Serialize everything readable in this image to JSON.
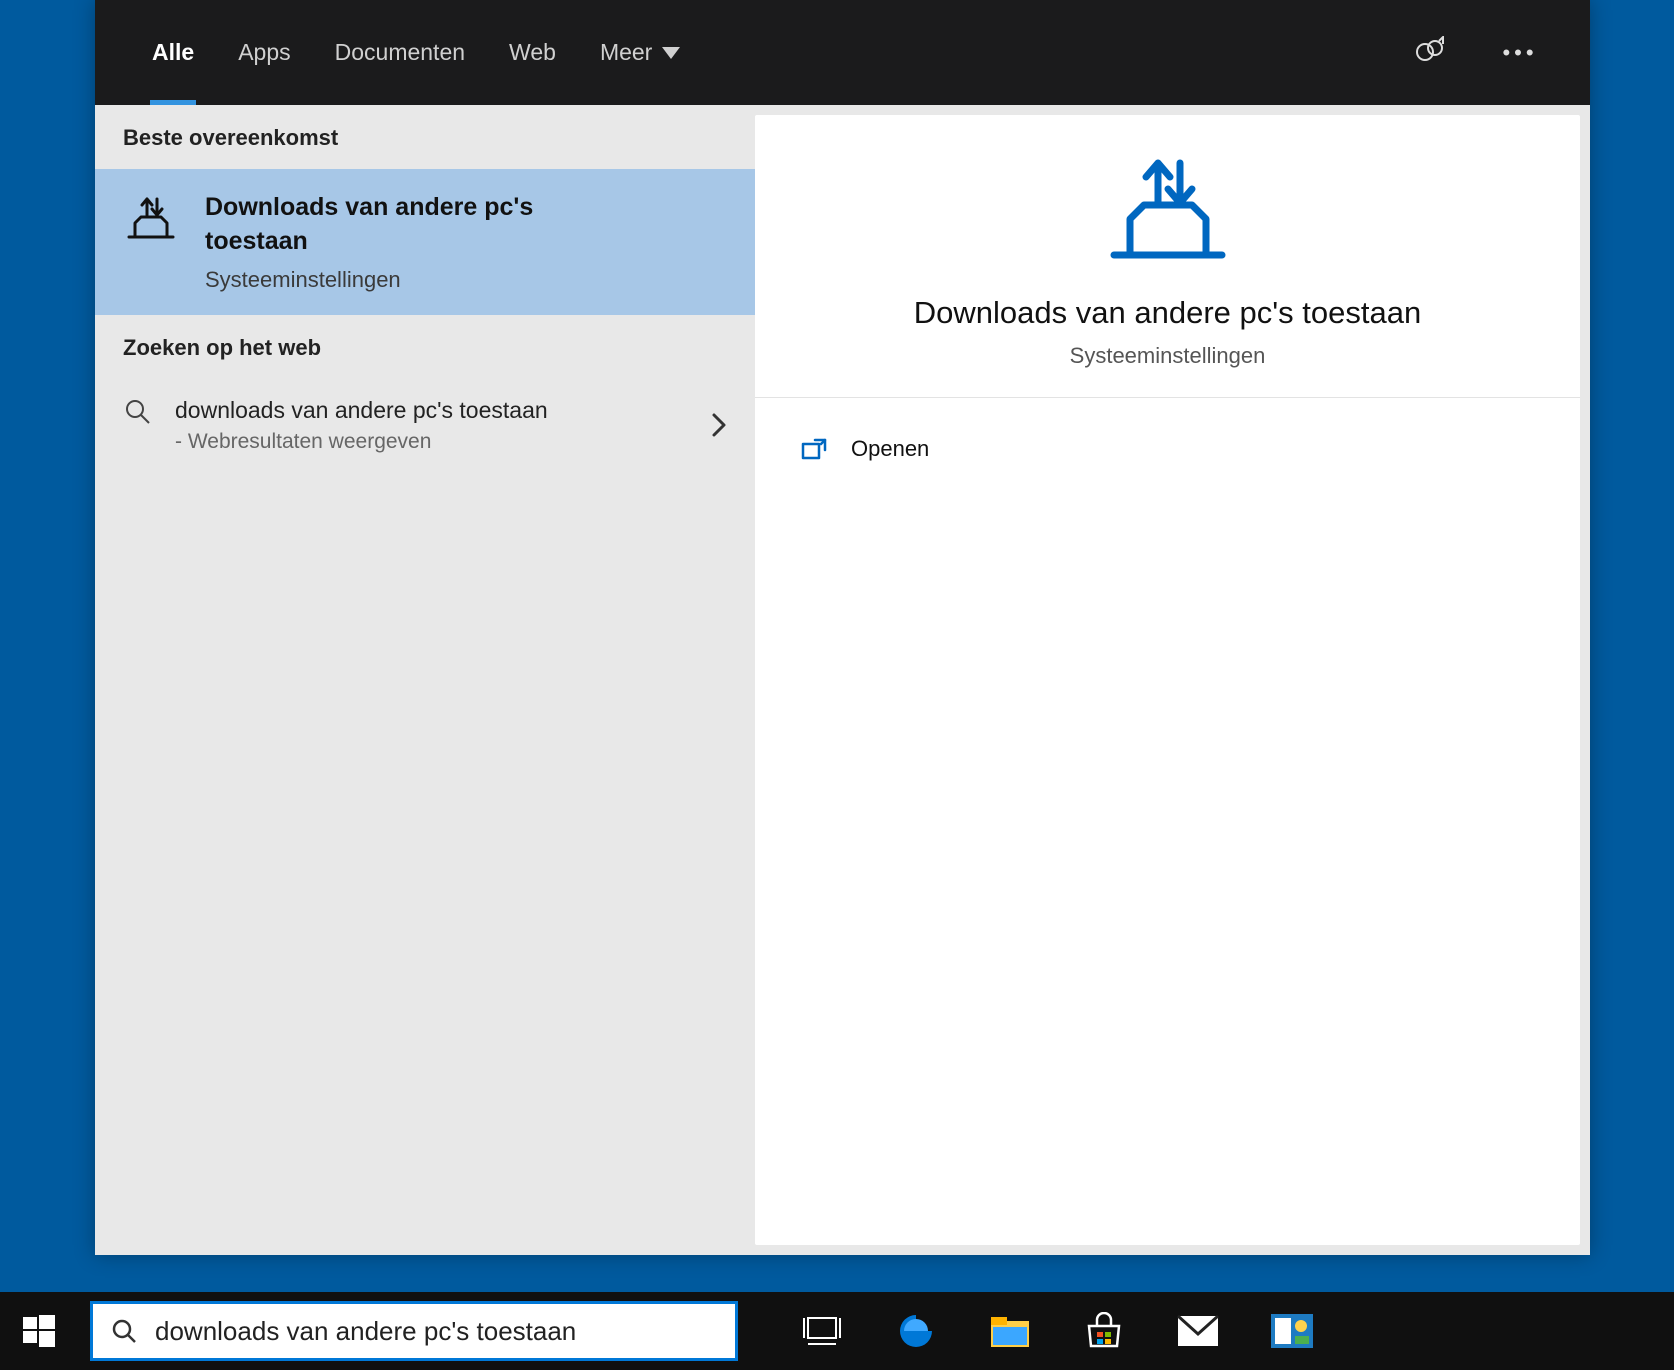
{
  "tabs": {
    "items": [
      {
        "label": "Alle",
        "active": true
      },
      {
        "label": "Apps",
        "active": false
      },
      {
        "label": "Documenten",
        "active": false
      },
      {
        "label": "Web",
        "active": false
      },
      {
        "label": "Meer",
        "active": false,
        "dropdown": true
      }
    ]
  },
  "leftPane": {
    "bestMatchLabel": "Beste overeenkomst",
    "bestMatch": {
      "title": "Downloads van andere pc's toestaan",
      "subtitle": "Systeeminstellingen"
    },
    "webSearchLabel": "Zoeken op het web",
    "webResult": {
      "title": "downloads van andere pc's toestaan",
      "subtitle": "- Webresultaten weergeven"
    }
  },
  "preview": {
    "title": "Downloads van andere pc's toestaan",
    "subtitle": "Systeeminstellingen",
    "actions": {
      "open": "Openen"
    }
  },
  "searchBox": {
    "value": "downloads van andere pc's toestaan"
  },
  "icons": {
    "feedback": "feedback-icon",
    "more": "more-icon",
    "search": "search-icon",
    "chevronRight": "chevron-right-icon",
    "chevronDown": "chevron-down-icon",
    "openExternal": "open-external-icon",
    "delivery": "delivery-optimization-icon"
  },
  "colors": {
    "accent": "#0078d7",
    "tabUnderline": "#3393df",
    "selection": "#a7c7e7"
  }
}
